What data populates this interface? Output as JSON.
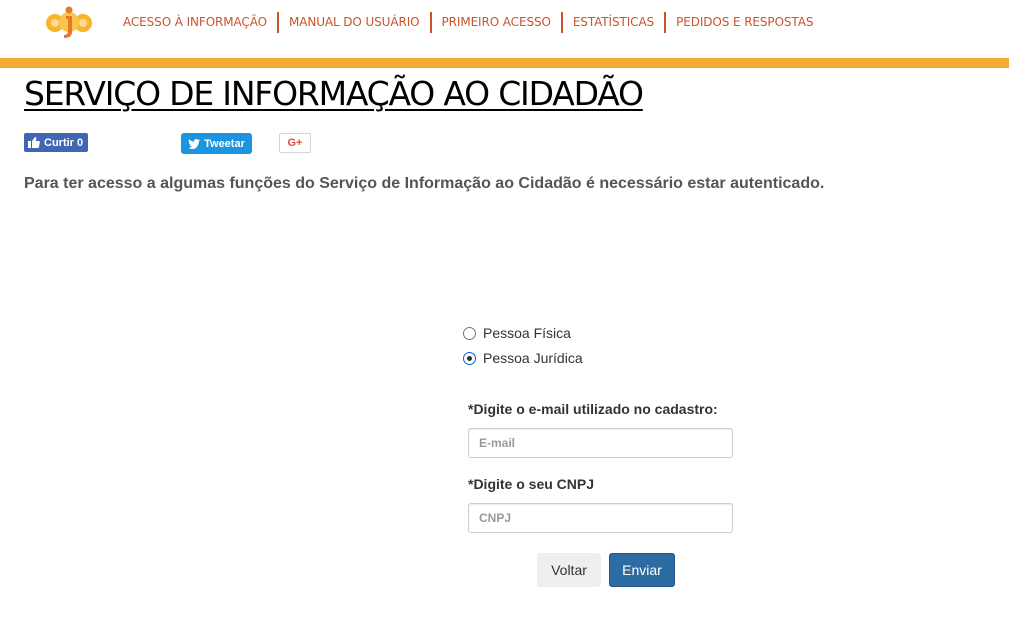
{
  "header": {
    "logo_text": "sic",
    "nav": [
      {
        "label": "ACESSO À INFORMAÇÃO"
      },
      {
        "label": "MANUAL DO USUÁRIO"
      },
      {
        "label": "PRIMEIRO ACESSO"
      },
      {
        "label": "ESTATÍSTICAS"
      },
      {
        "label": "PEDIDOS E RESPOSTAS"
      }
    ],
    "colors": {
      "nav_text": "#c8552b",
      "accent_bar": "#f3a933"
    }
  },
  "page": {
    "title": "SERVIÇO DE INFORMAÇÃO AO CIDADÃO",
    "intro": "Para ter acesso a algumas funções do Serviço de Informação ao Cidadão é necessário estar autenticado."
  },
  "social": {
    "facebook_label": "Curtir 0",
    "twitter_label": "Tweetar",
    "gplus_label": "G+"
  },
  "form": {
    "person_types": [
      {
        "label": "Pessoa Física",
        "checked": false
      },
      {
        "label": "Pessoa Jurídica",
        "checked": true
      }
    ],
    "email_label": "*Digite o e-mail utilizado no cadastro:",
    "email_placeholder": "E-mail",
    "email_value": "",
    "cnpj_label": "*Digite o seu CNPJ",
    "cnpj_placeholder": "CNPJ",
    "cnpj_value": "",
    "back_label": "Voltar",
    "submit_label": "Enviar"
  }
}
